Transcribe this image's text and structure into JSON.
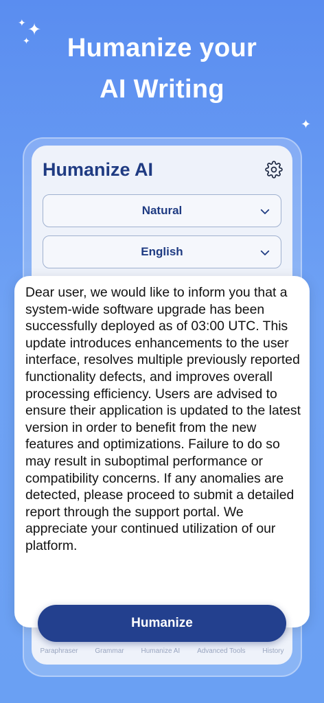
{
  "header": {
    "line1": "Humanize your",
    "line2": "AI Writing"
  },
  "app": {
    "title": "Humanize AI",
    "tone_select": "Natural",
    "language_select": "English"
  },
  "tabs": [
    "Paraphraser",
    "Grammar",
    "Humanize AI",
    "Advanced Tools",
    "History"
  ],
  "popup": {
    "message": "Dear user, we would like to inform you that a system-wide software upgrade has been successfully deployed as of 03:00 UTC. This update introduces enhancements to the user interface, resolves multiple previously reported functionality defects, and improves overall processing efficiency. Users are advised to ensure their application is updated to the latest version in order to benefit from the new features and optimizations. Failure to do so may result in suboptimal performance or compatibility concerns. If any anomalies are detected, please proceed to submit a detailed report through the support portal. We appreciate your continued utilization of our platform."
  },
  "primary_button": "Humanize",
  "icons": {
    "sparkles": "sparkle-icon",
    "settings": "gear-icon",
    "dropdown": "chevron-down-icon"
  },
  "colors": {
    "background": "#6a9cf2",
    "title_text": "#1f3b82",
    "button": "#23408e"
  }
}
